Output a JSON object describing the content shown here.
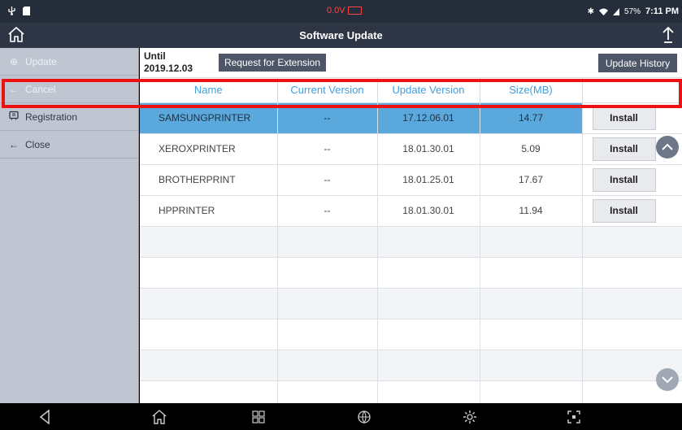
{
  "status_bar": {
    "left_icons": [
      "usb-icon",
      "sd-card-icon"
    ],
    "voltage": "0.0V",
    "battery_percent": "57%",
    "time": "7:11 PM"
  },
  "title_bar": {
    "title": "Software Update"
  },
  "sidebar": {
    "items": [
      {
        "label": "Update",
        "icon": "globe-icon",
        "enabled": false
      },
      {
        "label": "Cancel",
        "icon": "arrow-left-icon",
        "enabled": false
      },
      {
        "label": "Registration",
        "icon": "registration-icon",
        "enabled": true
      },
      {
        "label": "Close",
        "icon": "arrow-left-icon",
        "enabled": true
      }
    ]
  },
  "toolbar": {
    "until_label": "Until",
    "until_date": "2019.12.03",
    "extension_button": "Request for Extension",
    "history_button": "Update History"
  },
  "table": {
    "headers": [
      "Name",
      "Current Version",
      "Update Version",
      "Size(MB)",
      ""
    ],
    "rows": [
      {
        "name": "SAMSUNGPRINTER",
        "current": "--",
        "update": "17.12.06.01",
        "size": "14.77",
        "action": "Install",
        "selected": true
      },
      {
        "name": "XEROXPRINTER",
        "current": "--",
        "update": "18.01.30.01",
        "size": "5.09",
        "action": "Install",
        "selected": false
      },
      {
        "name": "BROTHERPRINT",
        "current": "--",
        "update": "18.01.25.01",
        "size": "17.67",
        "action": "Install",
        "selected": false
      },
      {
        "name": "HPPRINTER",
        "current": "--",
        "update": "18.01.30.01",
        "size": "11.94",
        "action": "Install",
        "selected": false
      }
    ]
  },
  "colors": {
    "header_text": "#3f9fe0",
    "selected_row": "#5ba9dc",
    "highlight_box": "#ee1111",
    "title_bar": "#2e3645"
  }
}
